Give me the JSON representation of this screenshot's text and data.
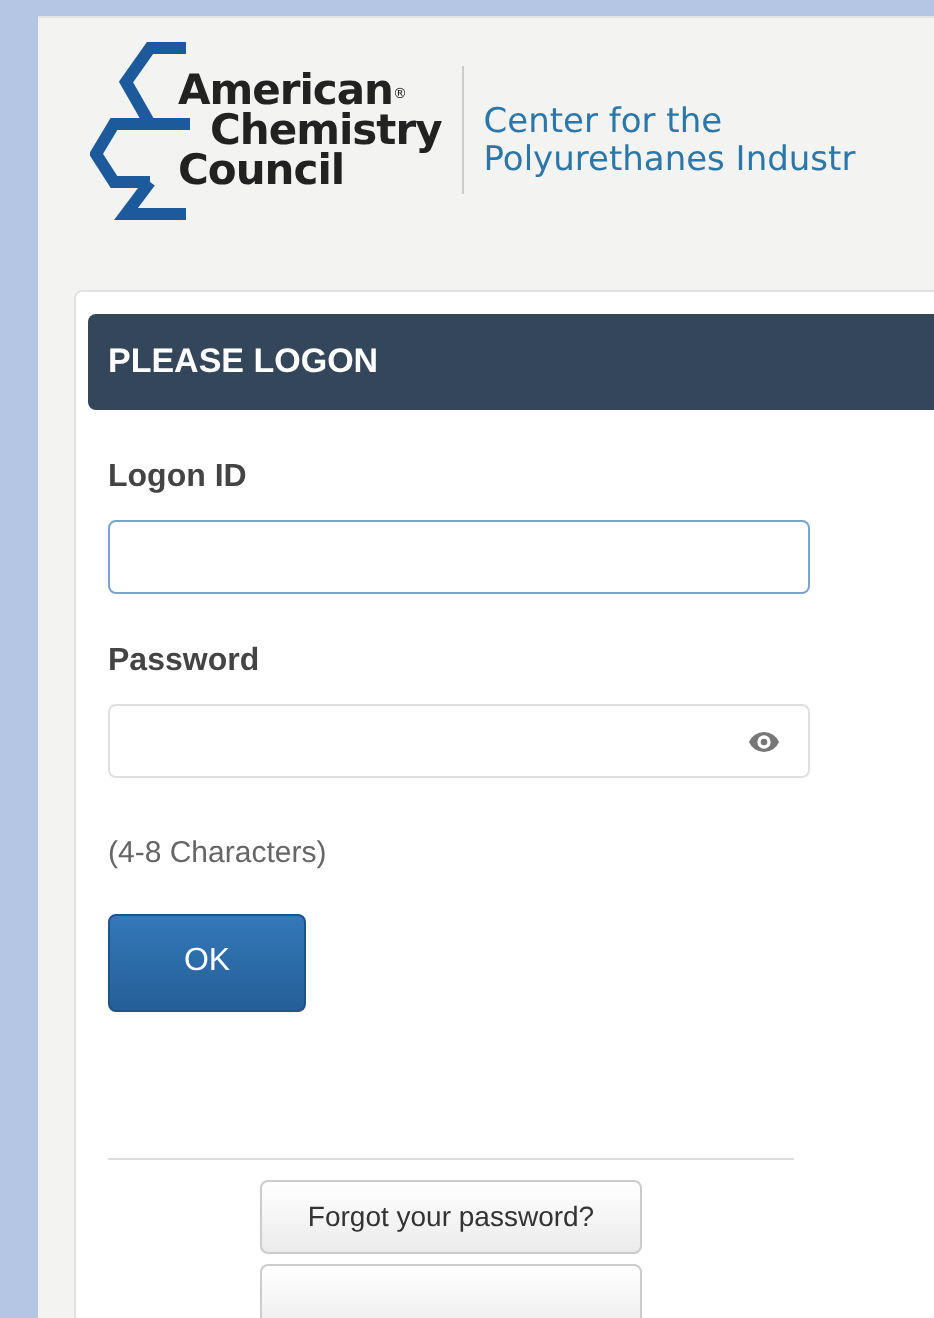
{
  "logo": {
    "lines": [
      "American",
      "Chemistry",
      "Council"
    ],
    "registered_mark": "®"
  },
  "tagline": [
    "Center for the",
    "Polyurethanes Industr"
  ],
  "panel": {
    "title": "PLEASE LOGON"
  },
  "fields": [
    {
      "label": "Logon ID",
      "kind": "text",
      "focused": true
    },
    {
      "label": "Password",
      "kind": "password",
      "focused": false
    }
  ],
  "hint": "(4-8 Characters)",
  "submit": "OK",
  "links": [
    "Forgot your password?"
  ]
}
